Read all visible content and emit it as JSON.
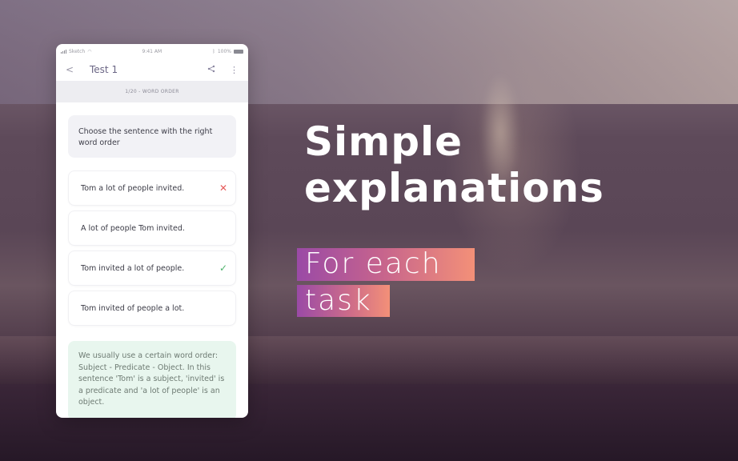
{
  "status_bar": {
    "carrier": "Sketch",
    "time": "9:41 AM",
    "battery": "100%",
    "icons": [
      "signal-icon",
      "wifi-icon",
      "bluetooth-icon",
      "battery-icon"
    ]
  },
  "app_bar": {
    "back_icon": "<",
    "title": "Test 1",
    "share_icon": "⋖",
    "more_icon": "⋮"
  },
  "progress": {
    "label": "1/20 - WORD ORDER",
    "current": 1,
    "total": 20
  },
  "question": {
    "text": "Choose the sentence with the right word order"
  },
  "options": [
    {
      "text": "Tom a lot of people invited.",
      "state": "wrong",
      "mark": "✕"
    },
    {
      "text": "A lot of people Tom invited.",
      "state": "none",
      "mark": ""
    },
    {
      "text": "Tom invited a lot of people.",
      "state": "correct",
      "mark": "✓"
    },
    {
      "text": "Tom invited of people a lot.",
      "state": "none",
      "mark": ""
    }
  ],
  "explanation": {
    "text": "We usually use a certain word order: Subject - Predicate - Object. In this sentence 'Tom' is a subject, 'invited' is a predicate and 'a lot of people' is an object."
  },
  "promo": {
    "headline_line1": "Simple",
    "headline_line2": "explanations",
    "tag_line1": "For each",
    "tag_line2": "task"
  },
  "colors": {
    "wrong": "#e55a5a",
    "correct": "#4db36b",
    "explanation_bg": "#e8f6ee",
    "tag_gradient_start": "#9a4aa6",
    "tag_gradient_end": "#f39078"
  }
}
